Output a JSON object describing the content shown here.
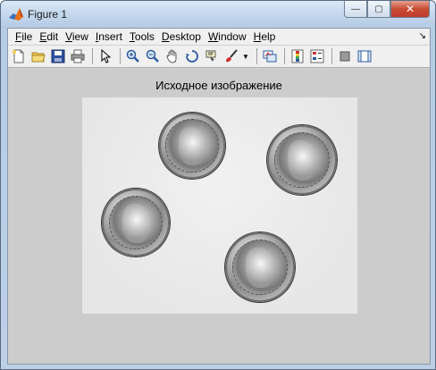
{
  "window": {
    "title": "Figure 1",
    "controls": {
      "minimize": "—",
      "maximize": "▢",
      "close": "✕"
    }
  },
  "menubar": {
    "items": [
      {
        "label": "File",
        "key": "F",
        "rest": "ile"
      },
      {
        "label": "Edit",
        "key": "E",
        "rest": "dit"
      },
      {
        "label": "View",
        "key": "V",
        "rest": "iew"
      },
      {
        "label": "Insert",
        "key": "I",
        "rest": "nsert"
      },
      {
        "label": "Tools",
        "key": "T",
        "rest": "ools"
      },
      {
        "label": "Desktop",
        "key": "D",
        "rest": "esktop"
      },
      {
        "label": "Window",
        "key": "W",
        "rest": "indow"
      },
      {
        "label": "Help",
        "key": "H",
        "rest": "elp"
      }
    ]
  },
  "toolbar": {
    "icons": [
      "new-figure-icon",
      "open-file-icon",
      "save-icon",
      "print-icon",
      "select-arrow-icon",
      "zoom-in-icon",
      "zoom-out-icon",
      "pan-hand-icon",
      "rotate-3d-icon",
      "data-cursor-icon",
      "brush-icon",
      "link-plot-icon",
      "colorbar-icon",
      "legend-icon",
      "hide-plot-tools-icon",
      "show-plot-tools-icon"
    ]
  },
  "axes": {
    "title": "Исходное изображение"
  },
  "colors": {
    "figure_background": "#cccccc",
    "image_background": "#ebebeb"
  }
}
